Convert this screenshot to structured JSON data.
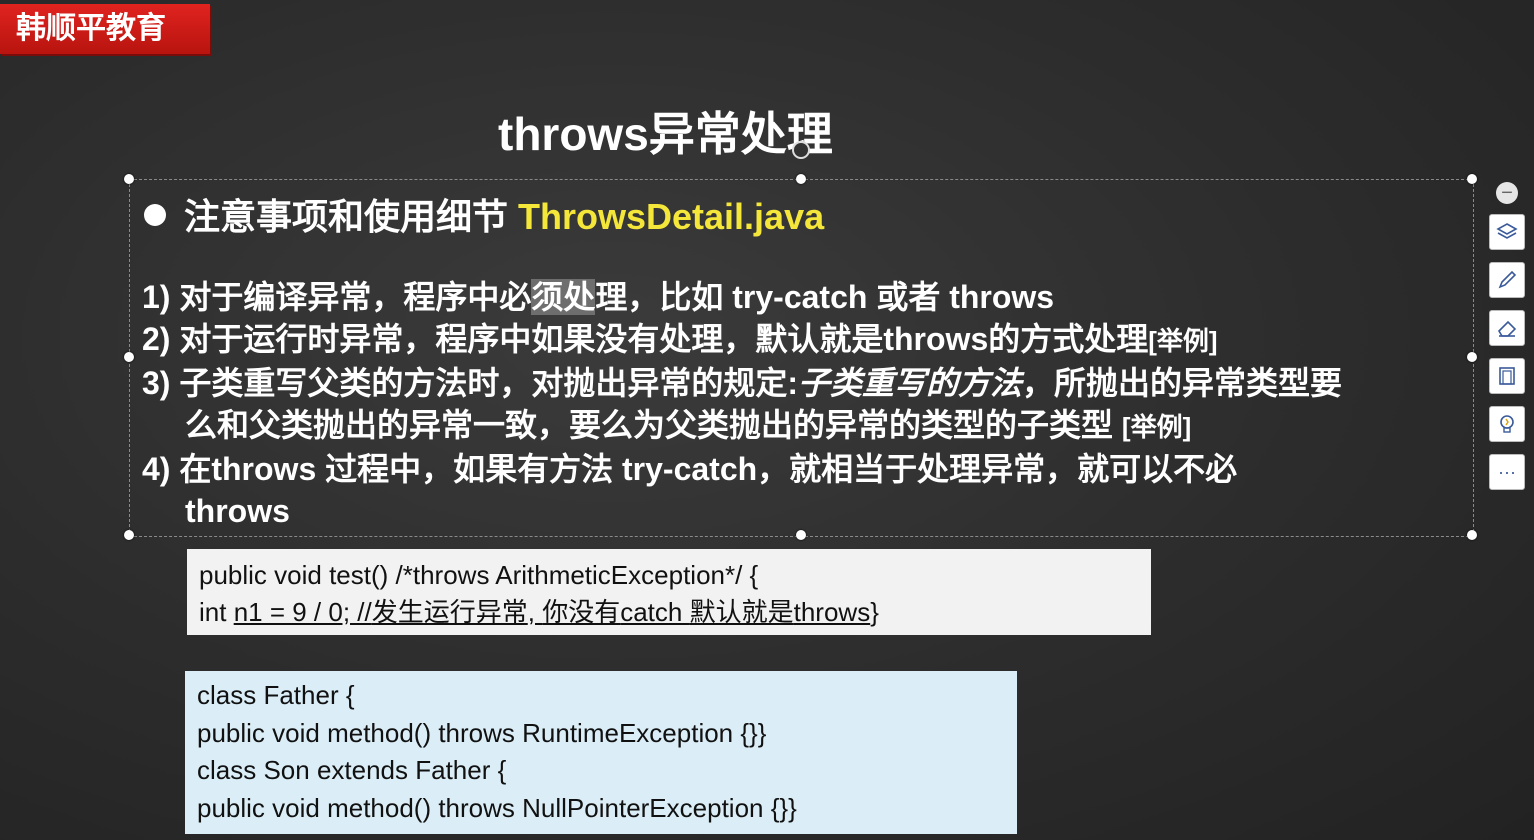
{
  "brand": "韩顺平教育",
  "slide": {
    "title": "throws异常处理",
    "bullet_text": "注意事项和使用细节 ",
    "bullet_file": "ThrowsDetail.java",
    "item1_a": "1) 对于编译异常，程序中必",
    "item1_hl": "须处",
    "item1_b": "理，比如 try-catch 或者 throws",
    "item2_a": "2) 对于运行时异常，程序中如果没有处理，默认就是throws的方式处理",
    "item2_tag": "[举例]",
    "item3_a": "3) 子类重写父类的方法时，对抛出异常的规定:",
    "item3_ital": "子类重写的方法",
    "item3_b": "，所抛出的异常类型要",
    "item3_c": "么和父类抛出的异常一致，要么为父类抛出的异常的类型的子类型 ",
    "item3_tag": "[举例]",
    "item4_a": "4) 在throws 过程中，如果有方法 try-catch，就相当于处理异常，就可以不必",
    "item4_b": "throws"
  },
  "code1": {
    "line1": "public void test() /*throws ArithmeticException*/ {",
    "line2_a": "int ",
    "line2_u1": "n1 = 9 / 0; //",
    "line2_cn1": "发生运行异常",
    "line2_u2": ", ",
    "line2_cn2": "你没有",
    "line2_u3": "catch ",
    "line2_cn3": "默认就是",
    "line2_u4": "throws",
    "line2_end": "}"
  },
  "code2": {
    "line1": "class Father {",
    "line2": "public void method() throws RuntimeException {}}",
    "line3": "class Son extends Father {",
    "line4": "public void method() throws NullPointerException {}}"
  },
  "toolbar": {
    "collapse": "−",
    "more": "···",
    "icons": [
      "layers-icon",
      "pen-icon",
      "eraser-icon",
      "frame-icon",
      "lightbulb-icon",
      "more-icon"
    ]
  }
}
